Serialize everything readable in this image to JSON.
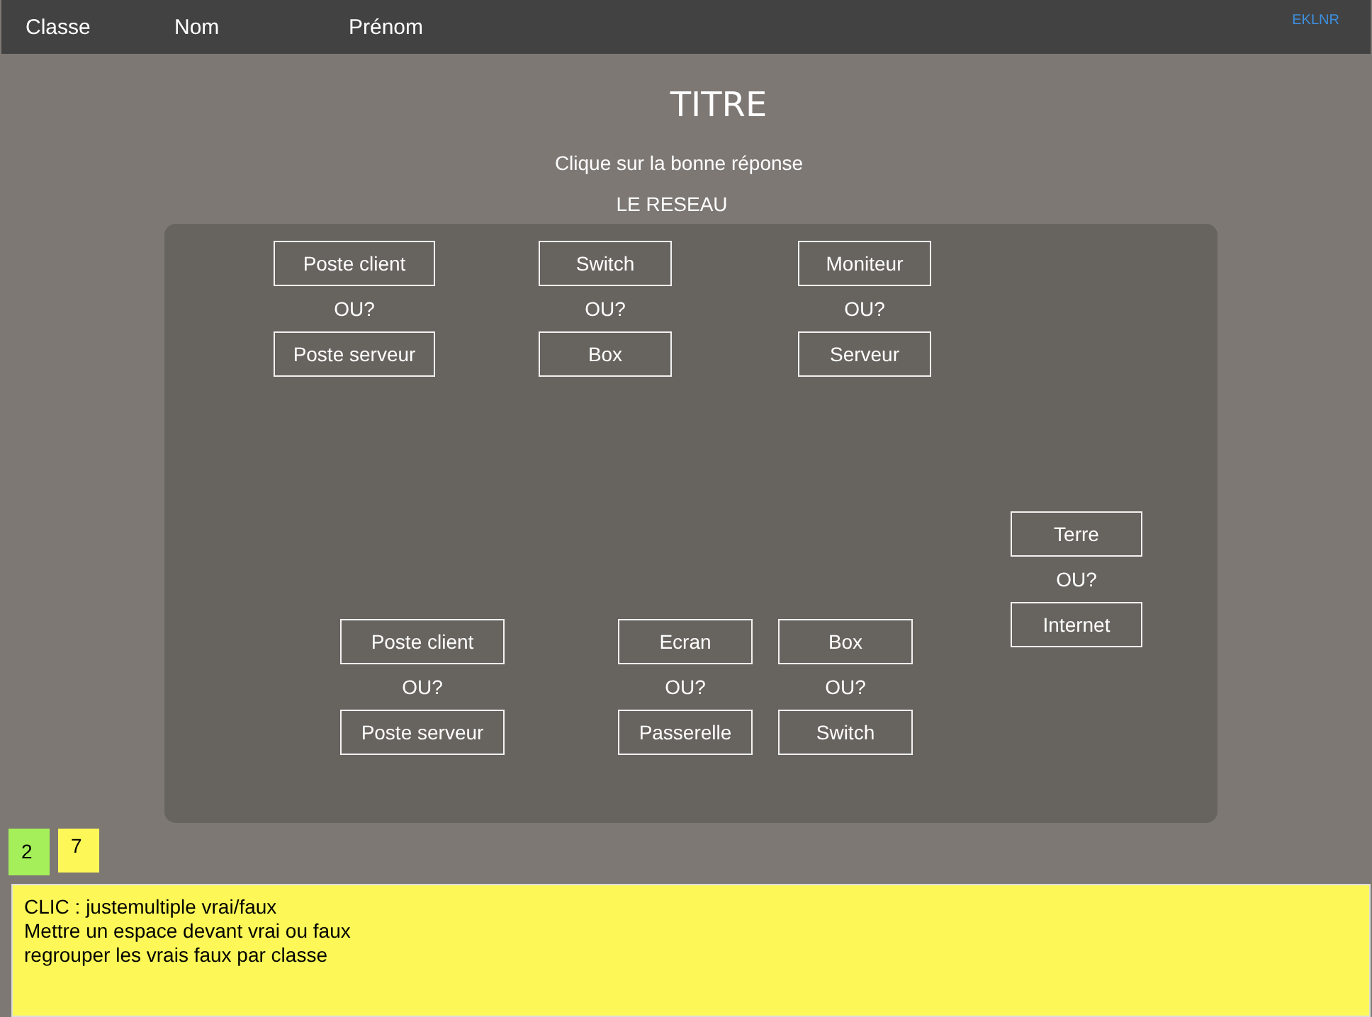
{
  "header": {
    "columns": [
      "Classe",
      "Nom",
      "Prénom"
    ],
    "code": "EKLNR"
  },
  "title": "TITRE",
  "instruction": "Clique sur la bonne réponse",
  "subtitle": "LE RESEAU",
  "choices": [
    {
      "options": [
        "Poste client",
        "Poste serveur"
      ],
      "separator": "OU?"
    },
    {
      "options": [
        "Switch",
        "Box"
      ],
      "separator": "OU?"
    },
    {
      "options": [
        "Moniteur",
        "Serveur"
      ],
      "separator": "OU?"
    },
    {
      "options": [
        "Terre",
        "Internet"
      ],
      "separator": "OU?"
    },
    {
      "options": [
        "Poste client",
        "Poste serveur"
      ],
      "separator": "OU?"
    },
    {
      "options": [
        "Ecran",
        "Passerelle"
      ],
      "separator": "OU?"
    },
    {
      "options": [
        "Box",
        "Switch"
      ],
      "separator": "OU?"
    }
  ],
  "counters": [
    {
      "value": "2",
      "color": "#a5ef5a"
    },
    {
      "value": "7",
      "color": "#fdf857"
    }
  ],
  "notes": [
    "CLIC :  justemultiple vrai/faux",
    "Mettre un espace devant vrai ou faux",
    "regrouper les vrais faux par classe"
  ]
}
